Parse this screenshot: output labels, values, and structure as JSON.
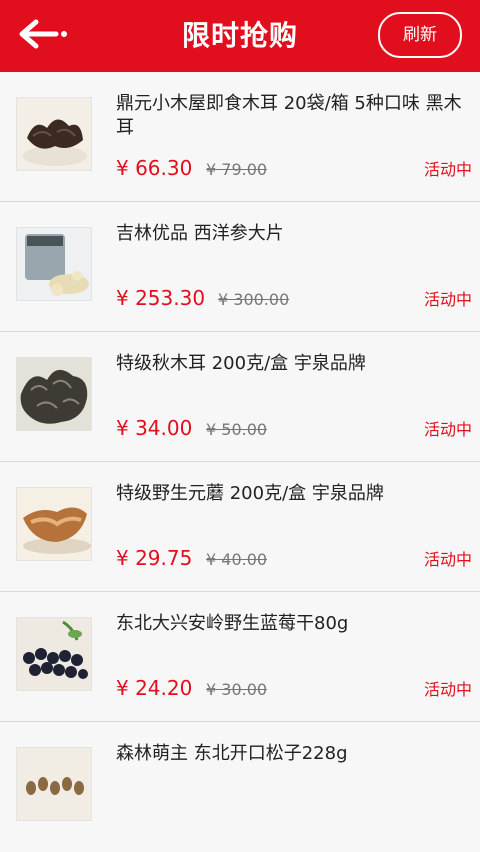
{
  "header": {
    "title": "限时抢购",
    "refresh_label": "刷新",
    "brand_color": "#e10f1e"
  },
  "items": [
    {
      "name": "鼎元小木屋即食木耳 20袋/箱 5种口味 黑木耳",
      "price": "¥ 66.30",
      "original_price": "¥ 79.00",
      "status": "活动中",
      "image": "black-fungus-bag"
    },
    {
      "name": "吉林优品 西洋参大片",
      "price": "¥ 253.30",
      "original_price": "¥ 300.00",
      "status": "活动中",
      "image": "ginseng-slices-jar"
    },
    {
      "name": "特级秋木耳 200克/盒 宇泉品牌",
      "price": "¥ 34.00",
      "original_price": "¥ 50.00",
      "status": "活动中",
      "image": "autumn-fungus"
    },
    {
      "name": "特级野生元蘑 200克/盒 宇泉品牌",
      "price": "¥ 29.75",
      "original_price": "¥ 40.00",
      "status": "活动中",
      "image": "dried-mushroom"
    },
    {
      "name": "东北大兴安岭野生蓝莓干80g",
      "price": "¥ 24.20",
      "original_price": "¥ 30.00",
      "status": "活动中",
      "image": "dried-blueberries"
    },
    {
      "name": "森林萌主 东北开口松子228g",
      "price": "",
      "original_price": "",
      "status": "",
      "image": "pine-nuts"
    }
  ]
}
